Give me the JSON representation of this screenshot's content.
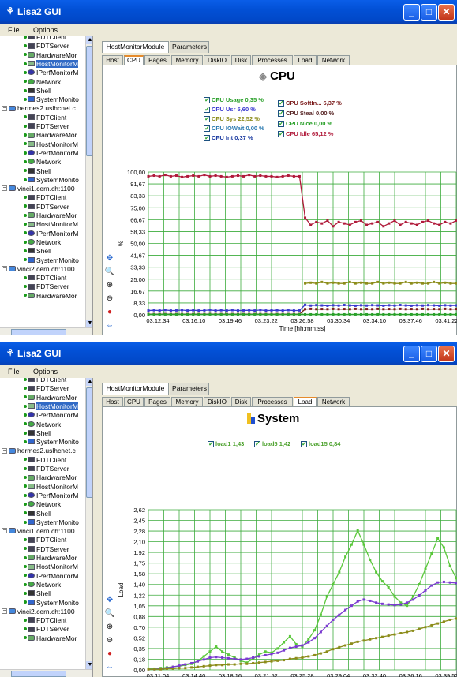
{
  "app": {
    "title": "Lisa2 GUI",
    "menu": [
      "File",
      "Options"
    ]
  },
  "tree_top": [
    {
      "label": "FDTClient",
      "icon": "server-icon"
    },
    {
      "label": "FDTServer",
      "icon": "server-icon"
    },
    {
      "label": "HardwareMor",
      "icon": "hardware-icon"
    },
    {
      "label": "HostMonitorM",
      "icon": "host-monitor-icon",
      "selected": true
    },
    {
      "label": "IPerfMonitorM",
      "icon": "iperf-icon"
    },
    {
      "label": "Network",
      "icon": "network-icon"
    },
    {
      "label": "Shell",
      "icon": "shell-icon"
    },
    {
      "label": "SystemMonito",
      "icon": "system-icon"
    },
    {
      "label": "hermes2.uslhcnet.c",
      "icon": "host-icon",
      "host": true
    },
    {
      "label": "FDTClient",
      "icon": "server-icon"
    },
    {
      "label": "FDTServer",
      "icon": "server-icon"
    },
    {
      "label": "HardwareMor",
      "icon": "hardware-icon"
    },
    {
      "label": "HostMonitorM",
      "icon": "host-monitor-icon"
    },
    {
      "label": "IPerfMonitorM",
      "icon": "iperf-icon"
    },
    {
      "label": "Network",
      "icon": "network-icon"
    },
    {
      "label": "Shell",
      "icon": "shell-icon"
    },
    {
      "label": "SystemMonito",
      "icon": "system-icon"
    },
    {
      "label": "vinci1.cern.ch:1100",
      "icon": "host-icon",
      "host": true
    },
    {
      "label": "FDTClient",
      "icon": "server-icon"
    },
    {
      "label": "FDTServer",
      "icon": "server-icon"
    },
    {
      "label": "HardwareMor",
      "icon": "hardware-icon"
    },
    {
      "label": "HostMonitorM",
      "icon": "host-monitor-icon"
    },
    {
      "label": "IPerfMonitorM",
      "icon": "iperf-icon"
    },
    {
      "label": "Network",
      "icon": "network-icon"
    },
    {
      "label": "Shell",
      "icon": "shell-icon"
    },
    {
      "label": "SystemMonito",
      "icon": "system-icon"
    },
    {
      "label": "vinci2.cern.ch:1100",
      "icon": "host-icon",
      "host": true
    },
    {
      "label": "FDTClient",
      "icon": "server-icon"
    },
    {
      "label": "FDTServer",
      "icon": "server-icon"
    },
    {
      "label": "HardwareMor",
      "icon": "hardware-icon"
    }
  ],
  "tabs": {
    "main": [
      "HostMonitorModule",
      "Parameters"
    ],
    "sub": [
      "Host",
      "CPU",
      "Pages",
      "Memory",
      "DiskIO",
      "Disk",
      "Processes",
      "Load",
      "Network"
    ]
  },
  "cpu_panel": {
    "title": "CPU",
    "selected_subtab": "CPU",
    "legend": [
      {
        "name": "CPU Usage",
        "value": "0,35 %",
        "color": "#2aa02a"
      },
      {
        "name": "CPU Usr",
        "value": "5,60 %",
        "color": "#3a3ad0"
      },
      {
        "name": "CPU Sys",
        "value": "22,52 %",
        "color": "#8c8c1a"
      },
      {
        "name": "CPU IOWait",
        "value": "0,00 %",
        "color": "#2a7ab0"
      },
      {
        "name": "CPU Int",
        "value": "0,37 %",
        "color": "#1a3aa0"
      },
      {
        "name": "CPU SoftIn...",
        "value": "6,37 %",
        "color": "#7a1a1a"
      },
      {
        "name": "CPU Steal",
        "value": "0,00 %",
        "color": "#552222"
      },
      {
        "name": "CPU Nice",
        "value": "0,00 %",
        "color": "#2aa02a"
      },
      {
        "name": "CPU Idle",
        "value": "65,12 %",
        "color": "#b01a3a"
      }
    ]
  },
  "load_panel": {
    "title": "System",
    "selected_subtab": "Load",
    "legend": [
      {
        "name": "load1",
        "value": "1,43",
        "color": "#5ac83a"
      },
      {
        "name": "load5",
        "value": "1,42",
        "color": "#7a3ad0"
      },
      {
        "name": "load15",
        "value": "0,84",
        "color": "#8c8c1a"
      }
    ]
  },
  "chart_data": [
    {
      "type": "line",
      "title": "CPU",
      "xlabel": "Time [hh:mm:ss]",
      "ylabel": "%",
      "ylim": [
        0,
        100
      ],
      "y_ticks": [
        "100,00",
        "91,67",
        "83,33",
        "75,00",
        "66,67",
        "58,33",
        "50,00",
        "41,67",
        "33,33",
        "25,00",
        "16,67",
        "8,33",
        "0,00"
      ],
      "x_ticks": [
        "03:12:34",
        "03:16:10",
        "03:19:46",
        "03:23:22",
        "03:26:58",
        "03:30:34",
        "03:34:10",
        "03:37:46",
        "03:41:22"
      ],
      "series": [
        {
          "name": "CPU Idle",
          "color": "#b01a3a",
          "values": [
            97,
            97.5,
            97,
            98,
            97,
            97.5,
            96.5,
            97,
            97.5,
            97,
            98,
            97,
            97.5,
            97,
            96.5,
            97,
            97.5,
            97,
            98,
            97,
            97.5,
            97,
            97,
            96.5,
            97,
            97.5,
            97,
            97,
            68,
            63,
            65,
            64,
            66,
            62,
            65,
            64,
            63,
            65,
            66,
            63,
            64,
            65,
            62,
            64,
            66,
            63,
            65,
            64,
            63,
            65,
            66,
            64,
            63,
            65,
            64,
            66
          ]
        },
        {
          "name": "CPU Sys",
          "color": "#8c8c1a",
          "values": [
            null,
            null,
            null,
            null,
            null,
            null,
            null,
            null,
            null,
            null,
            null,
            null,
            null,
            null,
            null,
            null,
            null,
            null,
            null,
            null,
            null,
            null,
            null,
            null,
            null,
            null,
            null,
            null,
            22,
            22.5,
            22,
            23,
            22,
            22.5,
            22,
            22,
            23,
            22,
            22.5,
            22,
            22,
            23,
            22,
            22.5,
            22,
            22,
            23,
            22,
            22.5,
            22,
            22,
            23,
            22,
            22.5,
            22,
            22
          ]
        },
        {
          "name": "CPU Usr",
          "color": "#3a3ad0",
          "values": [
            3,
            3.2,
            3,
            3.4,
            3,
            3.1,
            3.3,
            3,
            3.2,
            3,
            3.1,
            3.4,
            3,
            3.2,
            3,
            3.3,
            3,
            3.1,
            3.2,
            3,
            3.4,
            3,
            3.1,
            3.2,
            3,
            3.3,
            3,
            3.1,
            7,
            6.5,
            6.8,
            6.6,
            6.4,
            6.7,
            6.5,
            6.9,
            6.6,
            6.4,
            6.7,
            6.5,
            6.8,
            6.6,
            6.4,
            6.7,
            6.5,
            6.9,
            6.6,
            6.4,
            6.7,
            6.5,
            6.8,
            6.6,
            6.4,
            6.7,
            6.5,
            6.6
          ]
        },
        {
          "name": "CPU SoftIn...",
          "color": "#7a1a1a",
          "values": [
            0.5,
            0.5,
            0.5,
            0.5,
            0.5,
            0.5,
            0.5,
            0.5,
            0.5,
            0.5,
            0.5,
            0.5,
            0.5,
            0.5,
            0.5,
            0.5,
            0.5,
            0.5,
            0.5,
            0.5,
            0.5,
            0.5,
            0.5,
            0.5,
            0.5,
            0.5,
            0.5,
            0.5,
            4,
            4.2,
            4,
            4.1,
            4,
            4.2,
            4,
            4.1,
            4,
            4.2,
            4,
            4.1,
            4,
            4.2,
            4,
            4.1,
            4,
            4.2,
            4,
            4.1,
            4,
            4.2,
            4,
            4.1,
            4,
            4.2,
            4,
            4.1
          ]
        },
        {
          "name": "CPU Usage",
          "color": "#2aa02a",
          "values": [
            0.3,
            0.3,
            0.3,
            0.3,
            0.3,
            0.3,
            0.3,
            0.3,
            0.3,
            0.3,
            0.3,
            0.3,
            0.3,
            0.3,
            0.3,
            0.3,
            0.3,
            0.3,
            0.3,
            0.3,
            0.3,
            0.3,
            0.3,
            0.3,
            0.3,
            0.3,
            0.3,
            0.3,
            0.3,
            0.3,
            0.3,
            0.3,
            0.3,
            0.3,
            0.3,
            0.3,
            0.3,
            0.3,
            0.3,
            0.3,
            0.3,
            0.3,
            0.3,
            0.3,
            0.3,
            0.3,
            0.3,
            0.3,
            0.3,
            0.3,
            0.3,
            0.3,
            0.3,
            0.3,
            0.3,
            0.3
          ]
        }
      ]
    },
    {
      "type": "line",
      "title": "System",
      "xlabel": "Time [hh:mm:ss]",
      "ylabel": "Load",
      "ylim": [
        0,
        2.62
      ],
      "y_ticks": [
        "2,62",
        "2,45",
        "2,28",
        "2,10",
        "1,92",
        "1,75",
        "1,58",
        "1,40",
        "1,22",
        "1,05",
        "0,88",
        "0,70",
        "0,52",
        "0,35",
        "0,18",
        "0,00"
      ],
      "x_ticks": [
        "03:11:04",
        "03:14:40",
        "03:18:16",
        "03:21:52",
        "03:25:28",
        "03:29:04",
        "03:32:40",
        "03:36:16",
        "03:39:52"
      ],
      "series": [
        {
          "name": "load1",
          "color": "#5ac83a",
          "values": [
            0.02,
            0.02,
            0.03,
            0.04,
            0.05,
            0.06,
            0.08,
            0.1,
            0.14,
            0.22,
            0.3,
            0.38,
            0.3,
            0.25,
            0.2,
            0.15,
            0.12,
            0.18,
            0.25,
            0.3,
            0.28,
            0.35,
            0.45,
            0.55,
            0.42,
            0.38,
            0.5,
            0.65,
            0.9,
            1.2,
            1.4,
            1.6,
            1.85,
            2.05,
            2.28,
            2.05,
            1.8,
            1.6,
            1.45,
            1.35,
            1.2,
            1.1,
            1.05,
            1.2,
            1.4,
            1.65,
            1.9,
            2.15,
            2.0,
            1.7,
            1.5
          ]
        },
        {
          "name": "load5",
          "color": "#7a3ad0",
          "values": [
            0.01,
            0.01,
            0.02,
            0.03,
            0.05,
            0.07,
            0.09,
            0.11,
            0.14,
            0.17,
            0.2,
            0.21,
            0.2,
            0.19,
            0.18,
            0.17,
            0.18,
            0.2,
            0.22,
            0.24,
            0.26,
            0.28,
            0.32,
            0.36,
            0.38,
            0.4,
            0.45,
            0.52,
            0.62,
            0.72,
            0.82,
            0.9,
            0.98,
            1.05,
            1.12,
            1.15,
            1.13,
            1.1,
            1.08,
            1.07,
            1.06,
            1.07,
            1.1,
            1.15,
            1.22,
            1.3,
            1.38,
            1.43,
            1.44,
            1.43,
            1.42
          ]
        },
        {
          "name": "load15",
          "color": "#8c8c1a",
          "values": [
            0.01,
            0.01,
            0.01,
            0.02,
            0.02,
            0.03,
            0.03,
            0.04,
            0.05,
            0.06,
            0.07,
            0.08,
            0.08,
            0.09,
            0.09,
            0.1,
            0.1,
            0.11,
            0.12,
            0.13,
            0.14,
            0.15,
            0.16,
            0.18,
            0.19,
            0.2,
            0.22,
            0.24,
            0.27,
            0.3,
            0.34,
            0.37,
            0.4,
            0.43,
            0.46,
            0.48,
            0.5,
            0.52,
            0.54,
            0.56,
            0.58,
            0.6,
            0.62,
            0.64,
            0.67,
            0.7,
            0.73,
            0.76,
            0.79,
            0.82,
            0.84
          ]
        }
      ]
    }
  ]
}
